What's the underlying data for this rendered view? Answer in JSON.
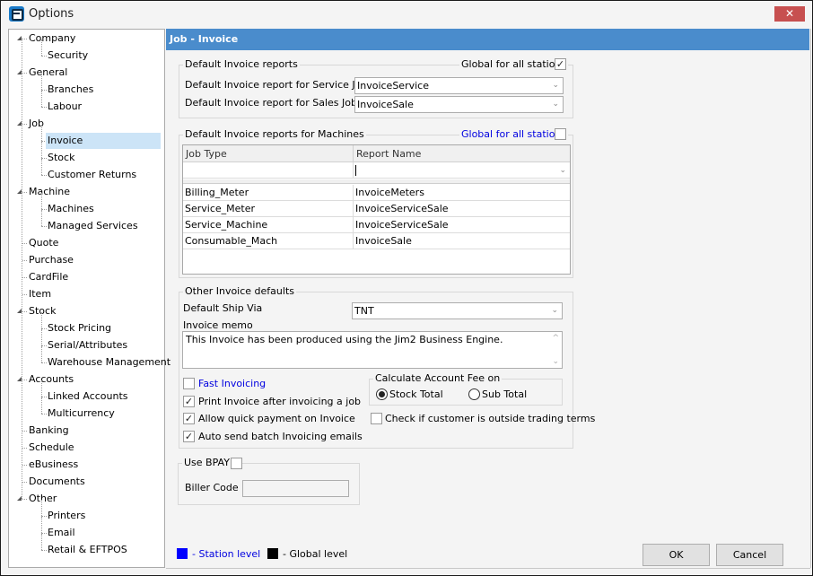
{
  "window": {
    "title": "Options",
    "close_label": "✕"
  },
  "tree": {
    "items": [
      {
        "label": "Company",
        "level": 0,
        "expanded": true
      },
      {
        "label": "Security",
        "level": 1
      },
      {
        "label": "General",
        "level": 0,
        "expanded": true
      },
      {
        "label": "Branches",
        "level": 1
      },
      {
        "label": "Labour",
        "level": 1
      },
      {
        "label": "Job",
        "level": 0,
        "expanded": true
      },
      {
        "label": "Invoice",
        "level": 1,
        "selected": true
      },
      {
        "label": "Stock",
        "level": 1
      },
      {
        "label": "Customer Returns",
        "level": 1
      },
      {
        "label": "Machine",
        "level": 0,
        "expanded": true
      },
      {
        "label": "Machines",
        "level": 1
      },
      {
        "label": "Managed Services",
        "level": 1
      },
      {
        "label": "Quote",
        "level": 0
      },
      {
        "label": "Purchase",
        "level": 0
      },
      {
        "label": "CardFile",
        "level": 0
      },
      {
        "label": "Item",
        "level": 0
      },
      {
        "label": "Stock",
        "level": 0,
        "expanded": true
      },
      {
        "label": "Stock Pricing",
        "level": 1
      },
      {
        "label": "Serial/Attributes",
        "level": 1
      },
      {
        "label": "Warehouse Management",
        "level": 1
      },
      {
        "label": "Accounts",
        "level": 0,
        "expanded": true
      },
      {
        "label": "Linked Accounts",
        "level": 1
      },
      {
        "label": "Multicurrency",
        "level": 1
      },
      {
        "label": "Banking",
        "level": 0
      },
      {
        "label": "Schedule",
        "level": 0
      },
      {
        "label": "eBusiness",
        "level": 0
      },
      {
        "label": "Documents",
        "level": 0
      },
      {
        "label": "Other",
        "level": 0,
        "expanded": true
      },
      {
        "label": "Printers",
        "level": 1
      },
      {
        "label": "Email",
        "level": 1
      },
      {
        "label": "Retail & EFTPOS",
        "level": 1
      }
    ]
  },
  "page": {
    "header": "Job - Invoice",
    "default_reports": {
      "group_label": "Default Invoice reports",
      "global_label": "Global for all stations",
      "global_checked": true,
      "service_job_label": "Default Invoice report for Service Job",
      "service_job_value": "InvoiceService",
      "sales_job_label": "Default Invoice report for Sales Job",
      "sales_job_value": "InvoiceSale"
    },
    "machine_reports": {
      "group_label": "Default Invoice reports for Machines",
      "global_label": "Global for all stations",
      "global_checked": false,
      "columns": [
        "Job Type",
        "Report Name"
      ],
      "new_row": {
        "job_type": "",
        "report_name": ""
      },
      "rows": [
        {
          "job_type": "Billing_Meter",
          "report_name": "InvoiceMeters"
        },
        {
          "job_type": "Service_Meter",
          "report_name": "InvoiceServiceSale"
        },
        {
          "job_type": "Service_Machine",
          "report_name": "InvoiceServiceSale"
        },
        {
          "job_type": "Consumable_Mach",
          "report_name": "InvoiceSale"
        }
      ]
    },
    "other_defaults": {
      "group_label": "Other Invoice defaults",
      "ship_via_label": "Default Ship Via",
      "ship_via_value": "TNT",
      "memo_label": "Invoice memo",
      "memo_value": "This Invoice has been produced using the Jim2 Business Engine.",
      "fast_invoicing_label": "Fast Invoicing",
      "fast_invoicing_checked": false,
      "print_invoice_label": "Print Invoice after invoicing a job",
      "print_invoice_checked": true,
      "quick_payment_label": "Allow quick payment on Invoice",
      "quick_payment_checked": true,
      "auto_send_label": "Auto send batch Invoicing emails",
      "auto_send_checked": true,
      "account_fee": {
        "group_label": "Calculate Account Fee on",
        "options": [
          "Stock Total",
          "Sub Total"
        ],
        "selected": "Stock Total"
      },
      "trading_terms_label": "Check if customer is outside trading terms",
      "trading_terms_checked": false
    },
    "bpay": {
      "label": "Use BPAY",
      "checked": false,
      "biller_code_label": "Biller Code",
      "biller_code_value": ""
    }
  },
  "footer": {
    "station_legend": "- Station level",
    "global_legend": "- Global level",
    "station_color": "#0000ff",
    "global_color": "#000000",
    "ok_label": "OK",
    "cancel_label": "Cancel"
  },
  "icons": {
    "check": "✓",
    "chevron": "⌄",
    "scroll_up": "^",
    "scroll_down": "⌄"
  }
}
